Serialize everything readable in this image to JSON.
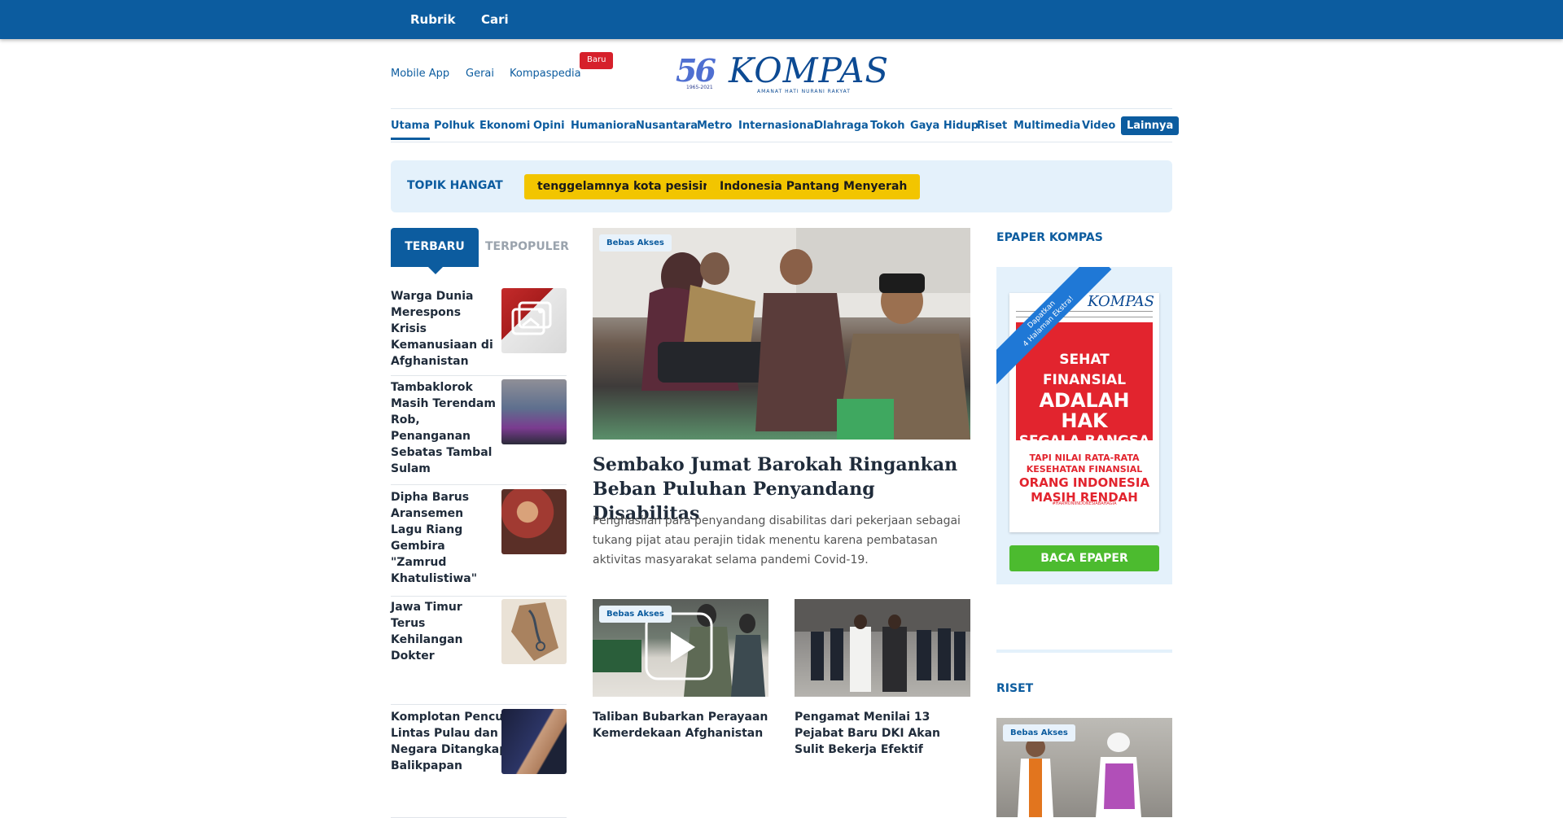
{
  "topbar": {
    "rubrik": "Rubrik",
    "cari": "Cari"
  },
  "utility": {
    "mobile_app": "Mobile App",
    "gerai": "Gerai",
    "kompaspedia": "Kompaspedia",
    "badge": "Baru"
  },
  "logo": {
    "anniversary": "56",
    "years": "1965-2021",
    "name": "KOMPAS",
    "tagline": "AMANAT HATI NURANI RAKYAT"
  },
  "nav": {
    "items": [
      "Utama",
      "Polhuk",
      "Ekonomi",
      "Opini",
      "Humaniora",
      "Nusantara",
      "Metro",
      "Internasional",
      "Olahraga",
      "Tokoh",
      "Gaya Hidup",
      "Riset",
      "Multimedia",
      "Video"
    ],
    "more": "Lainnya",
    "active": "Utama"
  },
  "topik": {
    "label": "TOPIK HANGAT",
    "chips": [
      "tenggelamnya kota pesisir",
      "Indonesia Pantang Menyerah"
    ]
  },
  "tabs": {
    "latest": "TERBARU",
    "popular": "TERPOPULER"
  },
  "latest": [
    {
      "title": "Warga Dunia Merespons Krisis Kemanusiaan di Afghanistan"
    },
    {
      "title": "Tambaklorok Masih Terendam Rob, Penanganan Sebatas Tambal Sulam"
    },
    {
      "title": "Dipha Barus Aransemen Lagu Riang Gembira \"Zamrud Khatulistiwa\""
    },
    {
      "title": "Jawa Timur Terus Kehilangan Dokter"
    },
    {
      "title": "Komplotan Pencuri Lintas Pulau dan Negara Ditangkap di Balikpapan"
    }
  ],
  "hero": {
    "badge": "Bebas Akses",
    "title": "Sembako Jumat Barokah Ringankan Beban Puluhan Penyandang Disabilitas",
    "summary": "Penghasilan para penyandang disabilitas dari pekerjaan sebagai tukang pijat atau perajin tidak menentu karena pembatasan aktivitas masyarakat selama pandemi Covid-19."
  },
  "cards": [
    {
      "badge": "Bebas Akses",
      "title": "Taliban Bubarkan Perayaan Kemerdekaan Afghanistan"
    },
    {
      "title": "Pengamat Menilai 13 Pejabat Baru DKI Akan Sulit Bekerja Efektif"
    }
  ],
  "epaper": {
    "heading": "EPAPER KOMPAS",
    "ribbon_1": "Dapatkan",
    "ribbon_2": "4 Halaman Ekstra!",
    "masthead": "KOMPAS",
    "headline_1": "SEHAT FINANSIAL",
    "headline_2": "ADALAH HAK",
    "headline_3": "SEGALA BANGSA",
    "sub_1": "TAPI NILAI RATA-RATA",
    "sub_2": "KESEHATAN FINANSIAL",
    "sub_3": "ORANG INDONESIA",
    "sub_4": "MASIH RENDAH",
    "footer": "#HARMONIINDONESIABAHAGIA",
    "button": "BACA EPAPER"
  },
  "riset": {
    "heading": "RISET",
    "badge": "Bebas Akses"
  },
  "colors": {
    "brand": "#0c5c9f",
    "chip": "#f2c500",
    "badge_red": "#d6202b",
    "cta_green": "#4cbb2f",
    "panel": "#e4f1fb"
  }
}
